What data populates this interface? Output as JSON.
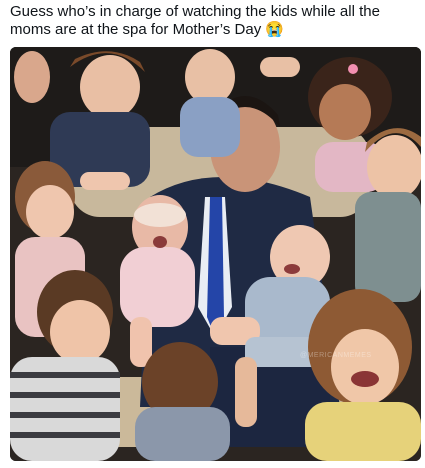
{
  "post": {
    "caption": "Guess who’s in charge of watching the kids while all the moms are at the spa for Mother’s Day 😭"
  },
  "image": {
    "watermark": "@MERICANMEMES"
  }
}
